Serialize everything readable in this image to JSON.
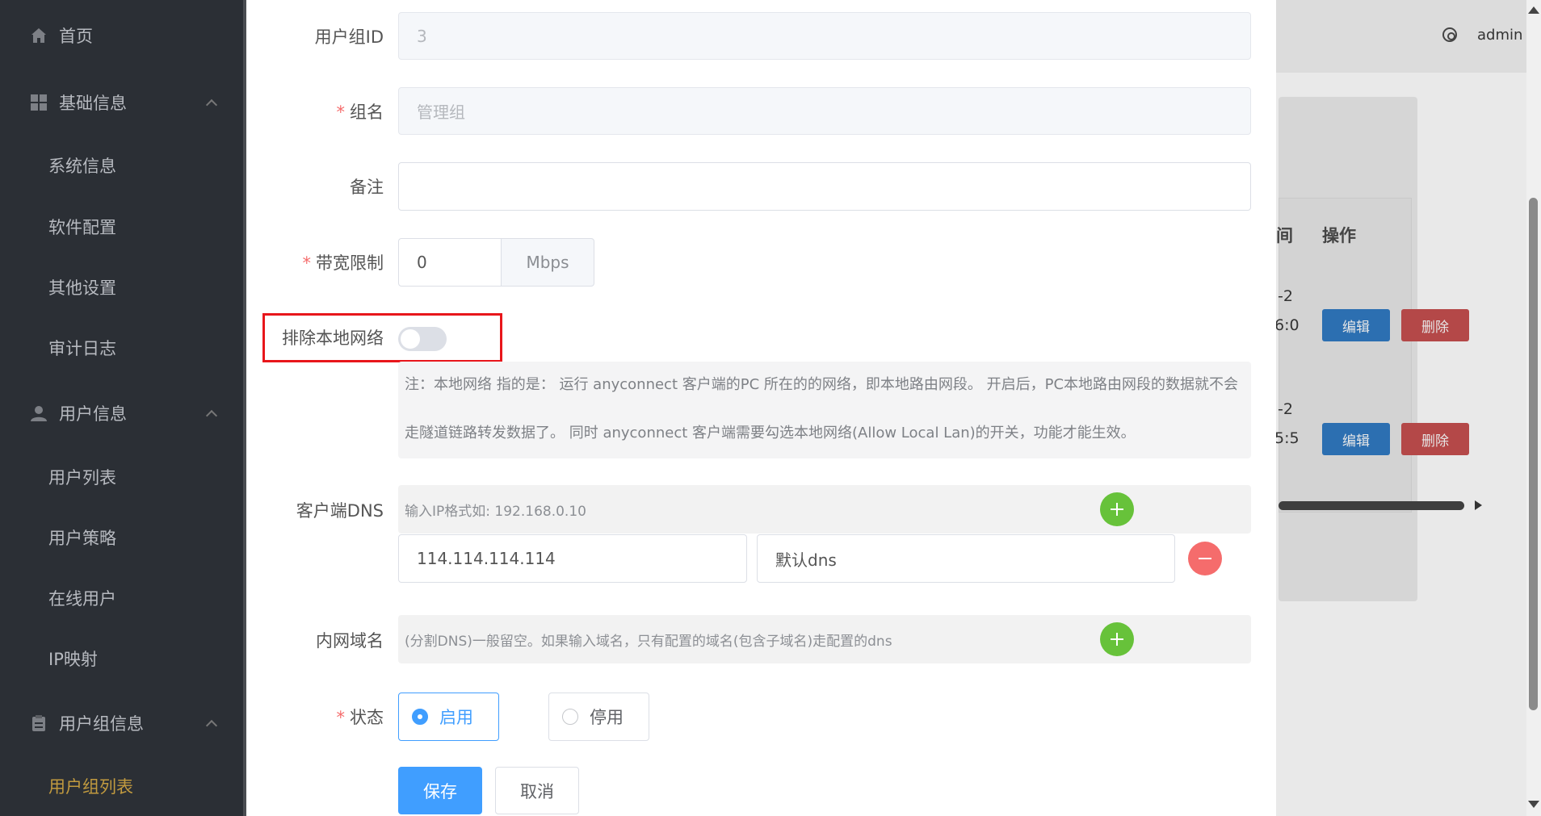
{
  "sidebar": {
    "items": [
      {
        "label": "首页",
        "icon": "home-icon"
      },
      {
        "label": "基础信息",
        "icon": "grid-icon"
      },
      {
        "label": "系统信息"
      },
      {
        "label": "软件配置"
      },
      {
        "label": "其他设置"
      },
      {
        "label": "审计日志"
      },
      {
        "label": "用户信息",
        "icon": "user-icon"
      },
      {
        "label": "用户列表"
      },
      {
        "label": "用户策略"
      },
      {
        "label": "在线用户"
      },
      {
        "label": "IP映射"
      },
      {
        "label": "用户组信息",
        "icon": "clipboard-icon"
      },
      {
        "label": "用户组列表"
      }
    ]
  },
  "header": {
    "user": "admin"
  },
  "background_table": {
    "col_partial": "间",
    "col_action": "操作",
    "rows": [
      {
        "line1": "-2",
        "line2": "6:0",
        "edit": "编辑",
        "delete": "删除"
      },
      {
        "line1": "-2",
        "line2": "5:5",
        "edit": "编辑",
        "delete": "删除"
      }
    ]
  },
  "form": {
    "group_id": {
      "label": "用户组ID",
      "value": "3"
    },
    "group_name": {
      "label": "组名",
      "placeholder": "管理组"
    },
    "remark": {
      "label": "备注",
      "value": ""
    },
    "bandwidth": {
      "label": "带宽限制",
      "value": "0",
      "unit": "Mbps"
    },
    "exclude_local": {
      "label": "排除本地网络",
      "enabled": false
    },
    "note": {
      "line1": "注：本地网络 指的是： 运行 anyconnect 客户端的PC 所在的的网络，即本地路由网段。 开启后，PC本地路由网段的数据就不会",
      "line2": "走隧道链路转发数据了。 同时 anyconnect 客户端需要勾选本地网络(Allow Local Lan)的开关，功能才能生效。"
    },
    "client_dns": {
      "label": "客户端DNS",
      "hint": "输入IP格式如: 192.168.0.10",
      "entries": [
        {
          "ip": "114.114.114.114",
          "remark": "默认dns"
        }
      ]
    },
    "intranet_domain": {
      "label": "内网域名",
      "hint": "(分割DNS)一般留空。如果输入域名，只有配置的域名(包含子域名)走配置的dns"
    },
    "status": {
      "label": "状态",
      "options": [
        "启用",
        "停用"
      ],
      "selected": "启用"
    },
    "save_label": "保存",
    "cancel_label": "取消"
  },
  "colors": {
    "primary": "#409eff",
    "success": "#67c23a",
    "danger": "#f56c6c",
    "sidebar_bg": "#2b2f35",
    "sidebar_active": "#c19a3f",
    "highlight_border": "#e8161b"
  }
}
